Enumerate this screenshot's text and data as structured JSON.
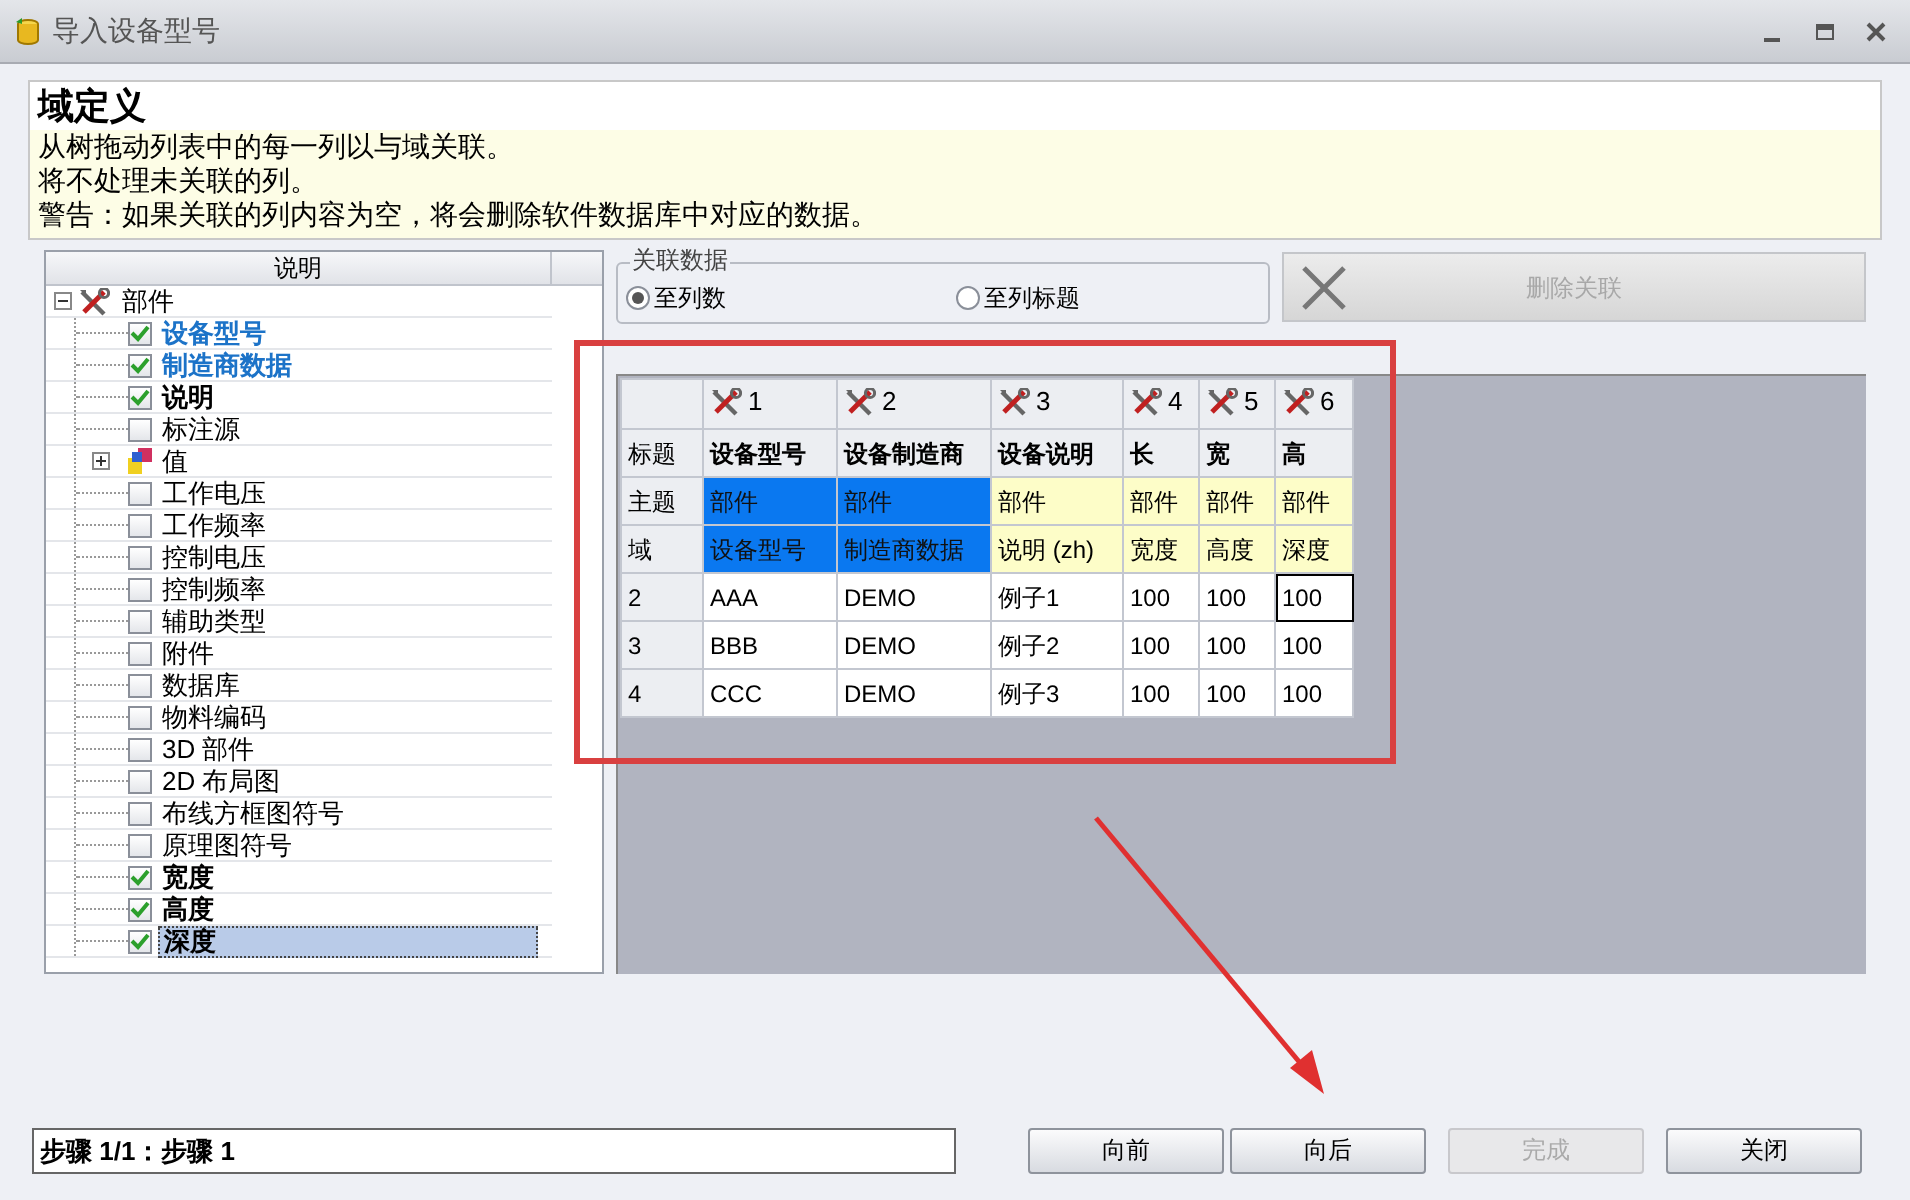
{
  "window": {
    "title": "导入设备型号"
  },
  "header": {
    "title": "域定义",
    "lines": [
      "从树拖动列表中的每一列以与域关联。",
      "将不处理未关联的列。",
      "警告：如果关联的列内容为空，将会删除软件数据库中对应的数据。"
    ]
  },
  "tree": {
    "column": "说明",
    "root": {
      "label": "部件",
      "expanded": true,
      "children": [
        {
          "kind": "check",
          "label": "设备型号",
          "checked": true,
          "linked": true,
          "bold": true,
          "selected": false
        },
        {
          "kind": "check",
          "label": "制造商数据",
          "checked": true,
          "linked": true,
          "bold": true,
          "selected": false
        },
        {
          "kind": "check",
          "label": "说明",
          "checked": true,
          "linked": false,
          "bold": true,
          "selected": false
        },
        {
          "kind": "check",
          "label": "标注源",
          "checked": false,
          "linked": false,
          "bold": false,
          "selected": false
        },
        {
          "kind": "group",
          "label": "值",
          "expanded": false
        },
        {
          "kind": "check",
          "label": "工作电压",
          "checked": false,
          "linked": false,
          "bold": false,
          "selected": false
        },
        {
          "kind": "check",
          "label": "工作频率",
          "checked": false,
          "linked": false,
          "bold": false,
          "selected": false
        },
        {
          "kind": "check",
          "label": "控制电压",
          "checked": false,
          "linked": false,
          "bold": false,
          "selected": false
        },
        {
          "kind": "check",
          "label": "控制频率",
          "checked": false,
          "linked": false,
          "bold": false,
          "selected": false
        },
        {
          "kind": "check",
          "label": "辅助类型",
          "checked": false,
          "linked": false,
          "bold": false,
          "selected": false
        },
        {
          "kind": "check",
          "label": "附件",
          "checked": false,
          "linked": false,
          "bold": false,
          "selected": false
        },
        {
          "kind": "check",
          "label": "数据库",
          "checked": false,
          "linked": false,
          "bold": false,
          "selected": false
        },
        {
          "kind": "check",
          "label": "物料编码",
          "checked": false,
          "linked": false,
          "bold": false,
          "selected": false
        },
        {
          "kind": "check",
          "label": "3D 部件",
          "checked": false,
          "linked": false,
          "bold": false,
          "selected": false
        },
        {
          "kind": "check",
          "label": "2D 布局图",
          "checked": false,
          "linked": false,
          "bold": false,
          "selected": false
        },
        {
          "kind": "check",
          "label": "布线方框图符号",
          "checked": false,
          "linked": false,
          "bold": false,
          "selected": false
        },
        {
          "kind": "check",
          "label": "原理图符号",
          "checked": false,
          "linked": false,
          "bold": false,
          "selected": false
        },
        {
          "kind": "check",
          "label": "宽度",
          "checked": true,
          "linked": false,
          "bold": true,
          "selected": false
        },
        {
          "kind": "check",
          "label": "高度",
          "checked": true,
          "linked": false,
          "bold": true,
          "selected": false
        },
        {
          "kind": "check",
          "label": "深度",
          "checked": true,
          "linked": false,
          "bold": true,
          "selected": true
        }
      ]
    }
  },
  "link_group": {
    "title": "关联数据",
    "options": [
      {
        "label": "至列数",
        "selected": true
      },
      {
        "label": "至列标题",
        "selected": false
      }
    ]
  },
  "delete_button": {
    "label": "删除关联",
    "disabled": true
  },
  "grid": {
    "columns": [
      "1",
      "2",
      "3",
      "4",
      "5",
      "6"
    ],
    "title_row": {
      "label": "标题",
      "cells": [
        "设备型号",
        "设备制造商",
        "设备说明",
        "长",
        "宽",
        "高"
      ]
    },
    "mapping_rows": [
      {
        "label": "主题",
        "cells": [
          {
            "text": "部件",
            "linked": true
          },
          {
            "text": "部件",
            "linked": true
          },
          {
            "text": "部件",
            "linked": false
          },
          {
            "text": "部件",
            "linked": false
          },
          {
            "text": "部件",
            "linked": false
          },
          {
            "text": "部件",
            "linked": false
          }
        ]
      },
      {
        "label": "域",
        "cells": [
          {
            "text": "设备型号",
            "linked": true
          },
          {
            "text": "制造商数据",
            "linked": true
          },
          {
            "text": "说明 (zh)",
            "linked": false
          },
          {
            "text": "宽度",
            "linked": false
          },
          {
            "text": "高度",
            "linked": false
          },
          {
            "text": "深度",
            "linked": false
          }
        ]
      }
    ],
    "data_rows": [
      {
        "label": "2",
        "cells": [
          {
            "text": "AAA",
            "focused": false
          },
          {
            "text": "DEMO",
            "focused": false
          },
          {
            "text": "例子1",
            "focused": false
          },
          {
            "text": "100",
            "focused": false
          },
          {
            "text": "100",
            "focused": false
          },
          {
            "text": "100",
            "focused": true
          }
        ]
      },
      {
        "label": "3",
        "cells": [
          {
            "text": "BBB",
            "focused": false
          },
          {
            "text": "DEMO",
            "focused": false
          },
          {
            "text": "例子2",
            "focused": false
          },
          {
            "text": "100",
            "focused": false
          },
          {
            "text": "100",
            "focused": false
          },
          {
            "text": "100",
            "focused": false
          }
        ]
      },
      {
        "label": "4",
        "cells": [
          {
            "text": "CCC",
            "focused": false
          },
          {
            "text": "DEMO",
            "focused": false
          },
          {
            "text": "例子3",
            "focused": false
          },
          {
            "text": "100",
            "focused": false
          },
          {
            "text": "100",
            "focused": false
          },
          {
            "text": "100",
            "focused": false
          }
        ]
      }
    ]
  },
  "status": "步骤 1/1：步骤 1",
  "buttons": [
    {
      "label": "向前",
      "disabled": false
    },
    {
      "label": "向后",
      "disabled": false
    },
    {
      "label": "完成",
      "disabled": true
    },
    {
      "label": "关闭",
      "disabled": false
    }
  ]
}
